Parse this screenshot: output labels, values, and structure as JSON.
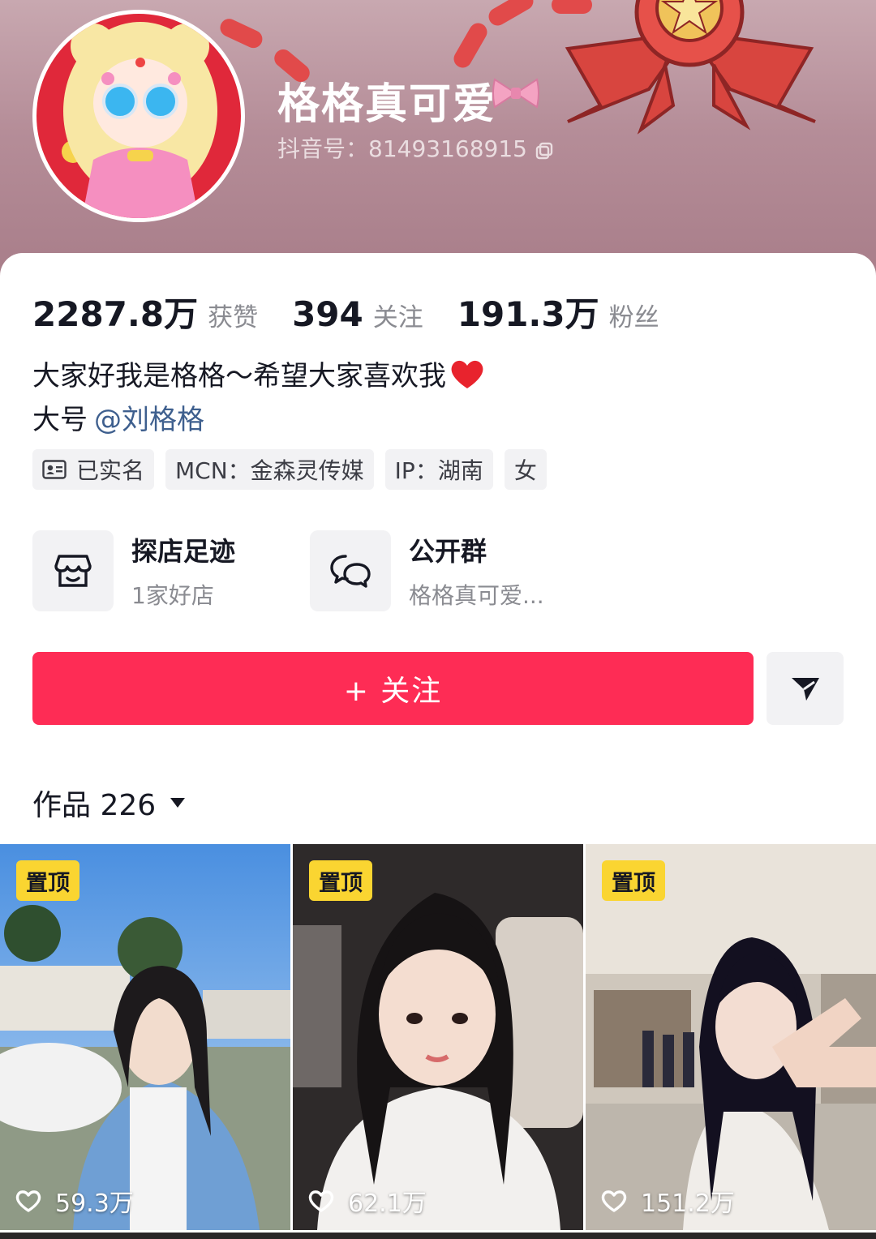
{
  "profile": {
    "nickname": "格格真可爱",
    "douyin_id": "抖音号：81493168915"
  },
  "stats": [
    {
      "value": "2287.8万",
      "label": "获赞"
    },
    {
      "value": "394",
      "label": "关注"
    },
    {
      "value": "191.3万",
      "label": "粉丝"
    }
  ],
  "bio": {
    "line1": "大家好我是格格～希望大家喜欢我",
    "line2_prefix": "大号",
    "line2_mention": "@刘格格"
  },
  "tags": [
    {
      "label": "已实名",
      "icon": "id-card-icon"
    },
    {
      "label": "MCN：金森灵传媒"
    },
    {
      "label": "IP：湖南"
    },
    {
      "label": "女"
    }
  ],
  "entries": [
    {
      "title": "探店足迹",
      "subtitle": "1家好店",
      "icon": "store-icon"
    },
    {
      "title": "公开群",
      "subtitle": "格格真可爱...",
      "icon": "chat-bubbles-icon"
    }
  ],
  "actions": {
    "follow_label": "+ 关注",
    "share_icon": "send-icon"
  },
  "works": {
    "label": "作品 226"
  },
  "videos": [
    {
      "badge": "置顶",
      "likes": "59.3万"
    },
    {
      "badge": "置顶",
      "likes": "62.1万"
    },
    {
      "badge": "置顶",
      "likes": "151.2万"
    }
  ],
  "colors": {
    "accent": "#fe2c55",
    "pin_badge": "#fad531",
    "mention": "#3e5f8e"
  }
}
